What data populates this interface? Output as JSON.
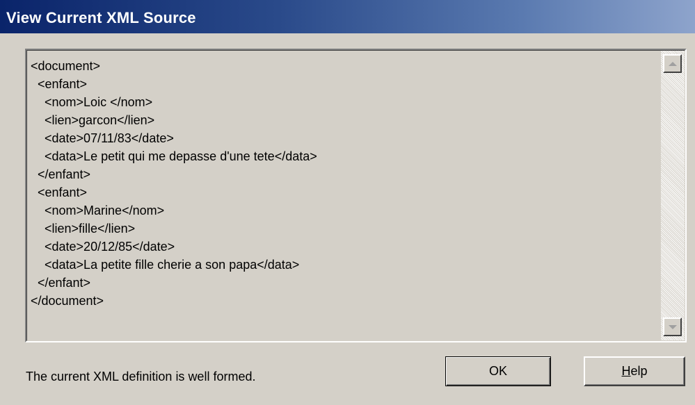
{
  "window": {
    "title": "View Current XML Source"
  },
  "source": {
    "lines": [
      "<document>",
      "  <enfant>",
      "    <nom>Loic </nom>",
      "    <lien>garcon</lien>",
      "    <date>07/11/83</date>",
      "    <data>Le petit qui me depasse d'une tete</data>",
      "  </enfant>",
      "  <enfant>",
      "    <nom>Marine</nom>",
      "    <lien>fille</lien>",
      "    <date>20/12/85</date>",
      "    <data>La petite fille cherie a son papa</data>",
      "  </enfant>",
      "</document>"
    ]
  },
  "scrollbar": {
    "up_icon": "scroll-up-arrow",
    "down_icon": "scroll-down-arrow"
  },
  "footer": {
    "status": "The current XML definition is well formed.",
    "ok_label": "OK",
    "help_label_prefix": "",
    "help_label_key": "H",
    "help_label_rest": "elp"
  },
  "colors": {
    "face": "#d4d0c8",
    "title_gradient_start": "#0a246a",
    "title_gradient_end": "#8ea4cc",
    "title_text": "#ffffff"
  }
}
